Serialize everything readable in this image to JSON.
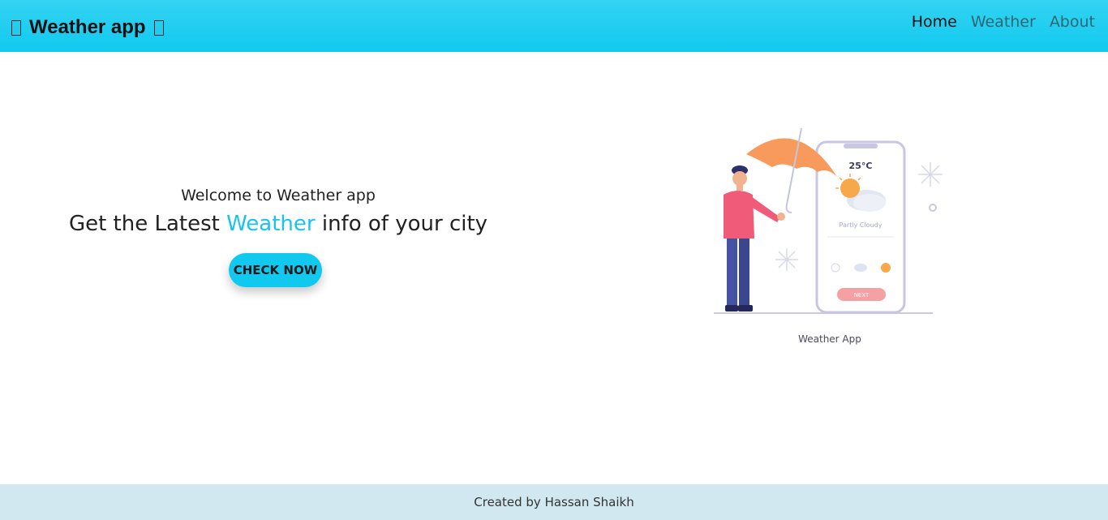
{
  "navbar": {
    "brand_title": "Weather app",
    "links": [
      {
        "label": "Home",
        "active": true
      },
      {
        "label": "Weather",
        "active": false
      },
      {
        "label": "About",
        "active": false
      }
    ]
  },
  "hero": {
    "welcome": "Welcome to Weather app",
    "headline_before": "Get the Latest",
    "headline_highlight": "Weather",
    "headline_after": "info of your city",
    "cta_label": "CHECK NOW",
    "accent_color": "#18c4ef"
  },
  "illustration": {
    "caption": "Weather App",
    "phone_temp": "25°C",
    "phone_condition": "Partly Cloudy",
    "phone_next_label": "NEXT"
  },
  "footer": {
    "text": "Created by Hassan Shaikh"
  }
}
